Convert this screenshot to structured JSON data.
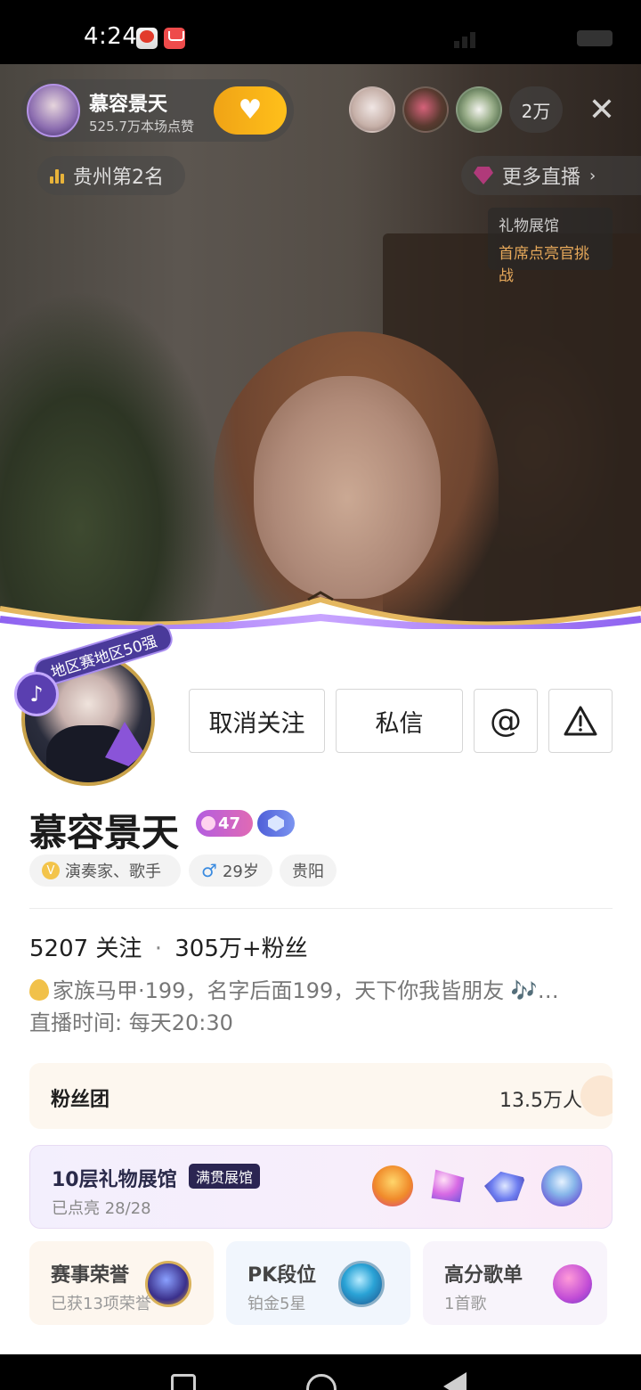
{
  "status_bar": {
    "time": "4:24"
  },
  "live": {
    "host_name": "慕容景天",
    "likes_text": "525.7万本场点赞",
    "viewer_count": "2万",
    "rank_text": "贵州第2名",
    "more_live_label": "更多直播",
    "gift_hall_title": "礼物展馆",
    "gift_hall_subtitle": "首席点亮官挑战"
  },
  "profile": {
    "avatar_badge": "地区赛地区50强",
    "buttons": {
      "unfollow": "取消关注",
      "message": "私信",
      "at": "@"
    },
    "name": "慕容景天",
    "level": "47",
    "tags": {
      "occupation": "演奏家、歌手",
      "gender_age": "29岁",
      "city": "贵阳"
    },
    "stats": {
      "following": "5207 关注",
      "separator": "·",
      "followers": "305万+粉丝"
    },
    "bio": "家族马甲·199，名字后面199，天下你我皆朋友 🎶…",
    "live_time": "直播时间: 每天20:30"
  },
  "fan_club": {
    "label": "粉丝团",
    "count": "13.5万人"
  },
  "gift_gallery": {
    "title": "10层礼物展馆",
    "badge": "满贯展馆",
    "progress": "已点亮  28/28"
  },
  "cards": [
    {
      "title": "赛事荣誉",
      "subtitle": "已获13项荣誉"
    },
    {
      "title": "PK段位",
      "subtitle": "铂金5星"
    },
    {
      "title": "高分歌单",
      "subtitle": "1首歌"
    }
  ]
}
